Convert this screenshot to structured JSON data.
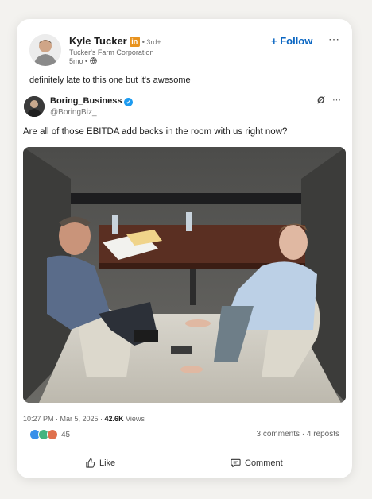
{
  "author": {
    "name": "Kyle Tucker",
    "badge": "in",
    "degree": "• 3rd+",
    "headline": "Tucker's Farm Corporation",
    "time": "5mo •"
  },
  "header": {
    "follow_label": "+ Follow",
    "more_label": "⋯"
  },
  "commentary": "definitely late to this one but it's awesome",
  "tweet": {
    "name": "Boring_Business",
    "handle": "@BoringBiz_",
    "text": "Are all of those EBITDA add backs in the room with us right now?",
    "more_label": "⋯",
    "timestamp": "10:27 PM · Mar 5, 2025 · ",
    "views_count": "42.6K",
    "views_label": " Views"
  },
  "social": {
    "reaction_count": "45",
    "comments_reposts": "3 comments · 4 reposts"
  },
  "actions": {
    "like_label": "Like",
    "comment_label": "Comment"
  },
  "colors": {
    "accent": "#0a66c2",
    "verified": "#1d9bf0",
    "reaction_like": "#378fe9",
    "reaction_celebrate": "#44b37f",
    "reaction_love": "#df704d"
  }
}
